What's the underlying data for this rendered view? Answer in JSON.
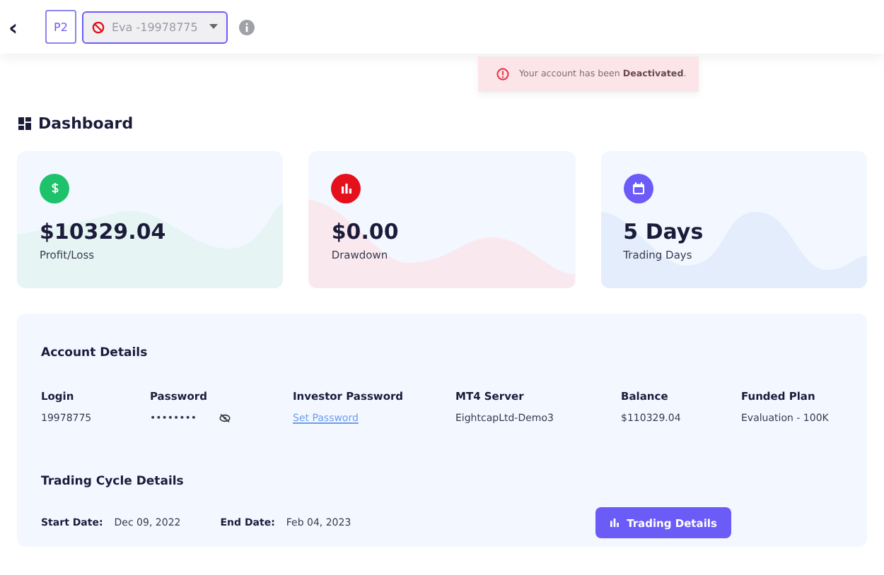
{
  "header": {
    "back": "‹",
    "badge": "P2",
    "account_select": {
      "value": "Eva -19978775",
      "disabled": true
    }
  },
  "toast": {
    "message": "Your account has been **Deactivated**."
  },
  "page_title": "Dashboard",
  "stats": [
    {
      "value": "$10329.04",
      "label": "Profit/Loss",
      "kind": "dollar",
      "color": "#1ec26b"
    },
    {
      "value": "$0.00",
      "label": "Drawdown",
      "kind": "chart",
      "color": "#e5101c"
    },
    {
      "value": "5 Days",
      "label": "Trading Days",
      "kind": "calendar",
      "color": "#6c5cf7"
    }
  ],
  "account_details": {
    "title": "Account Details",
    "fields": [
      {
        "label": "Login",
        "value": "19978775",
        "kind": "text"
      },
      {
        "label": "Password",
        "value": "••••••••",
        "kind": "secret"
      },
      {
        "label": "Investor Password",
        "value": "Set Password",
        "kind": "link"
      },
      {
        "label": "MT4 Server",
        "value": "EightcapLtd-Demo3",
        "kind": "text"
      },
      {
        "label": "Balance",
        "value": "$110329.04",
        "kind": "text"
      },
      {
        "label": "Funded Plan",
        "value": "Evaluation - 100K",
        "kind": "text"
      }
    ]
  },
  "trading_cycle": {
    "title": "Trading Cycle Details",
    "start_label": "Start Date:",
    "start": "Dec 09, 2022",
    "end_label": "End Date:",
    "end": "Feb 04, 2023",
    "button": "Trading Details"
  }
}
